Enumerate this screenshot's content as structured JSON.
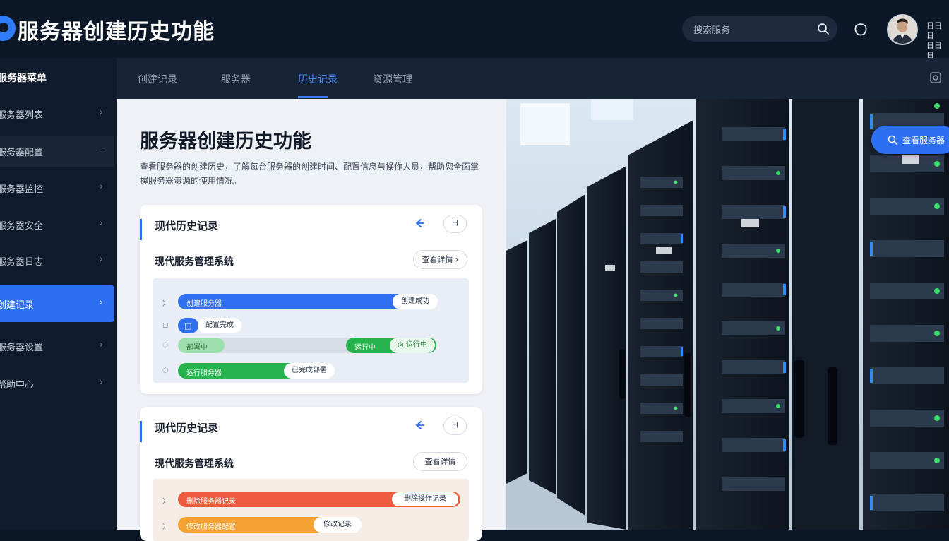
{
  "header": {
    "app_title": "服务器创建历史功能",
    "search_placeholder": "搜索服务",
    "user_meta": [
      "日日日",
      "日日日"
    ]
  },
  "sidebar": {
    "heading": "服务器菜单",
    "items": [
      {
        "label": "服务器列表",
        "state": "collapsed"
      },
      {
        "label": "服务器配置",
        "state": "expanded"
      },
      {
        "label": "服务器监控",
        "state": "collapsed"
      },
      {
        "label": "服务器安全",
        "state": "collapsed"
      },
      {
        "label": "服务器日志",
        "state": "collapsed"
      },
      {
        "label": "创建记录",
        "state": "active"
      },
      {
        "label": "服务器设置",
        "state": "collapsed"
      },
      {
        "label": "帮助中心",
        "state": "collapsed"
      }
    ]
  },
  "tabs": {
    "items": [
      "创建记录",
      "服务器",
      "历史记录",
      "资源管理"
    ],
    "active_index": 2
  },
  "main": {
    "title": "服务器创建历史功能",
    "description": "查看服务器的创建历史，了解每台服务器的创建时间、配置信息与操作人员，帮助您全面掌握服务器资源的使用情况。"
  },
  "cards": [
    {
      "title": "现代历史记录",
      "button": "日",
      "subtitle": "现代服务管理系统",
      "pill": "查看详情",
      "rows": [
        {
          "marker": "〉",
          "bar_label": "创建服务器",
          "chip": "创建成功",
          "color": "#2f6ff0"
        },
        {
          "marker": "◻",
          "bar_label": "",
          "chip": "配置完成",
          "color": "#2f6ff0"
        },
        {
          "marker": "◌",
          "bar_label": "部署中",
          "chip": "运行中",
          "badge": "◎ 运行中",
          "color": "#26b24c"
        },
        {
          "marker": "◌",
          "bar_label": "运行服务器",
          "chip": "已完成部署",
          "color": "#26b24c"
        }
      ]
    },
    {
      "title": "现代历史记录",
      "button": "日",
      "subtitle": "现代服务管理系统",
      "pill": "查看详情",
      "rows": [
        {
          "marker": "〉",
          "bar_label": "删除服务器记录",
          "chip": "删除操作记录",
          "color": "#ee5b3f"
        },
        {
          "marker": "〉",
          "bar_label": "修改服务器配置",
          "chip": "修改记录",
          "color": "#f4a233"
        }
      ]
    }
  ],
  "photo": {
    "button_label": "查看服务器 ↗"
  },
  "colors": {
    "accent": "#2d6ff2",
    "header_bg": "#0c1728",
    "sidebar_bg": "#0f1b2c",
    "content_bg": "#eef1f5",
    "success": "#26b24c",
    "danger": "#ee5b3f",
    "warning": "#f4a233"
  },
  "icons": {
    "search": "search-icon",
    "notify": "bell-icon",
    "chevron": "chevron-right-icon",
    "expanded": "minus-icon",
    "back": "arrow-left-icon"
  }
}
